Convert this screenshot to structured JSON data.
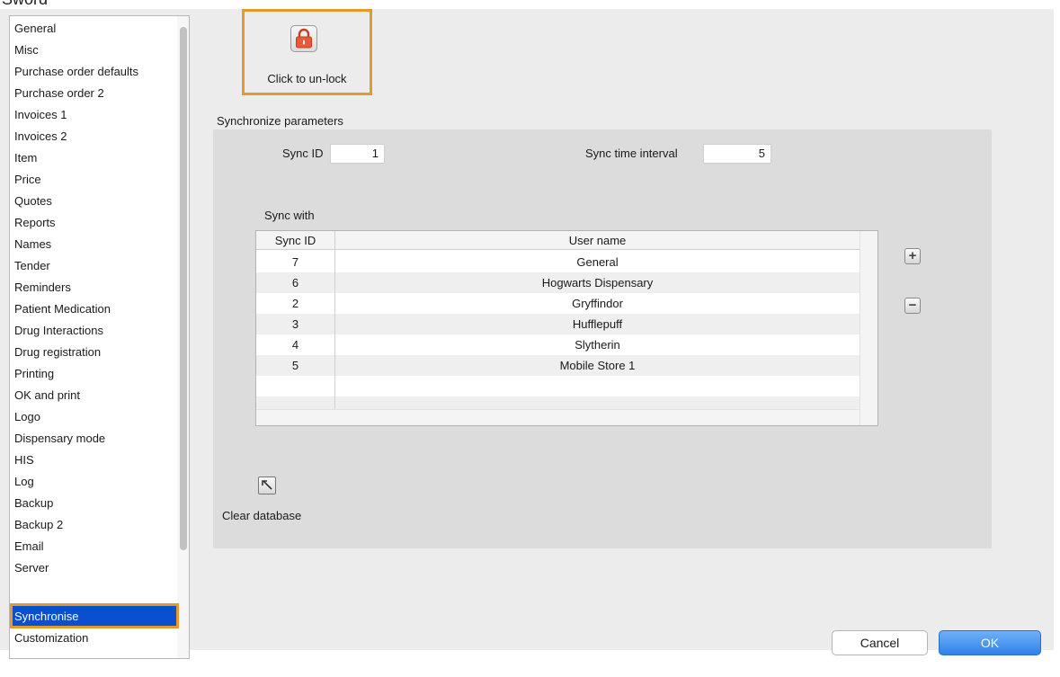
{
  "sidebar": {
    "items": [
      "General",
      "Misc",
      "Purchase order defaults",
      "Purchase order 2",
      "Invoices 1",
      "Invoices 2",
      "Item",
      "Price",
      "Quotes",
      "Reports",
      "Names",
      "Tender",
      "Reminders",
      "Patient Medication",
      "Drug Interactions",
      "Drug registration",
      "Printing",
      "OK and print",
      "Logo",
      "Dispensary mode",
      "HIS",
      "Log",
      "Backup",
      "Backup 2",
      "Email",
      "Server",
      "Synchronise",
      "Customization"
    ],
    "selected": "Synchronise"
  },
  "lock": {
    "label": "Click to un-lock",
    "icon": "padlock-icon",
    "color": "#e8593a"
  },
  "sync_params": {
    "section_label": "Synchronize parameters",
    "sync_id_label": "Sync ID",
    "sync_id_value": "1",
    "interval_label": "Sync time interval",
    "interval_value": "5"
  },
  "sync_with": {
    "label": "Sync with",
    "columns": [
      "Sync ID",
      "User name"
    ],
    "rows": [
      {
        "id": "7",
        "name": "General"
      },
      {
        "id": "6",
        "name": "Hogwarts Dispensary"
      },
      {
        "id": "2",
        "name": "Gryffindor"
      },
      {
        "id": "3",
        "name": "Hufflepuff"
      },
      {
        "id": "4",
        "name": "Slytherin"
      },
      {
        "id": "5",
        "name": "Mobile Store 1"
      }
    ],
    "add_icon": "plus-icon",
    "remove_icon": "minus-icon"
  },
  "clear_db": {
    "label": "Clear database",
    "icon": "clear-database-icon"
  },
  "buttons": {
    "cancel": "Cancel",
    "ok": "OK"
  },
  "colors": {
    "highlight": "#e49a2a",
    "selection": "#0a4fcf",
    "ok_button": "#3b8cf0"
  }
}
